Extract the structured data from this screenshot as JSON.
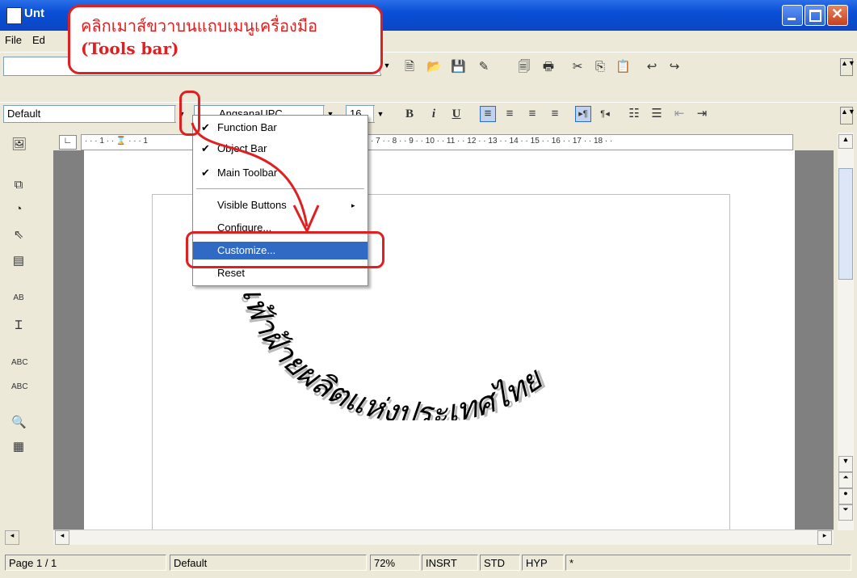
{
  "window": {
    "title": "Unt"
  },
  "menubar": {
    "file": "File",
    "edit": "Ed"
  },
  "toolbar": {
    "style_value": "Default",
    "font_value": "AngsanaUPC",
    "size_value": "16"
  },
  "context_menu": {
    "items": [
      {
        "label": "Function Bar",
        "checked": true
      },
      {
        "label": "Object Bar",
        "checked": true
      },
      {
        "label": "Main Toolbar",
        "checked": true
      },
      {
        "label": "Visible Buttons",
        "submenu": true
      },
      {
        "label": "Configure..."
      },
      {
        "label": "Customize...",
        "highlighted": true
      },
      {
        "label": "Reset"
      }
    ]
  },
  "callout": {
    "line1": "คลิกเมาส์ขวาบนแถบเมนูเครื่องมือ",
    "line2": "(Tools bar)"
  },
  "ruler": {
    "ticks": "· 7 · · 8 · · 9 · · 10 · · 11 · · 12 · · 13 · · 14 · · 15 · · 16 · · 17 · · 18 · ·",
    "left_ticks": "· · · 1 · · ⌛ · · · 1"
  },
  "document": {
    "wordart_text": "เฟ้าฝ้ายผลิตแห่งประเทศไทย"
  },
  "statusbar": {
    "page": "Page 1 / 1",
    "style": "Default",
    "zoom": "72%",
    "insert": "INSRT",
    "std": "STD",
    "hyp": "HYP",
    "modified": "*"
  },
  "colors": {
    "titlebar": "#0a4fd6",
    "callout": "#e02020",
    "highlight": "#316ac5"
  }
}
